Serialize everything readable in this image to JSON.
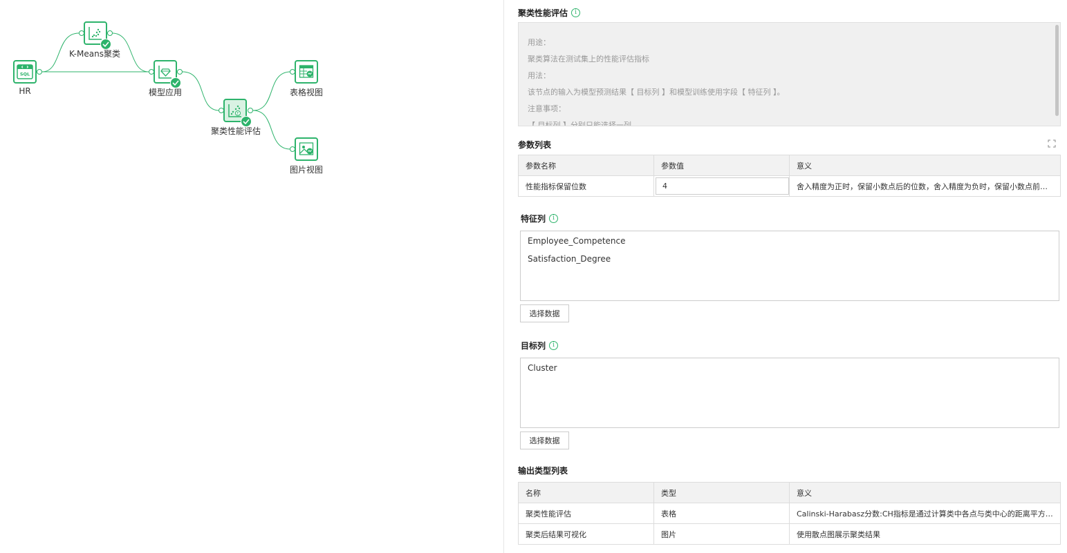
{
  "canvas": {
    "nodes": {
      "hr": {
        "label": "HR",
        "icon": "sql-icon",
        "icon_text": "SQL"
      },
      "kmeans": {
        "label": "K-Means聚类",
        "icon": "scatter-icon"
      },
      "model_apply": {
        "label": "模型应用",
        "icon": "gem-icon"
      },
      "cluster_eval": {
        "label": "聚类性能评估",
        "icon": "scatter-eval-icon"
      },
      "table_view": {
        "label": "表格视图",
        "icon": "table-view-icon"
      },
      "image_view": {
        "label": "图片视图",
        "icon": "image-view-icon"
      }
    },
    "accent_color": "#2db36b"
  },
  "panel": {
    "title": "聚类性能评估",
    "description": [
      "用途：",
      "聚类算法在测试集上的性能评估指标",
      "用法：",
      "该节点的输入为模型预测结果【 目标列 】和模型训练使用字段【 特征列 】。",
      "注意事项：",
      "【 目标列 】分别只能选择一列"
    ],
    "params": {
      "title": "参数列表",
      "headers": [
        "参数名称",
        "参数值",
        "意义"
      ],
      "rows": [
        {
          "name": "性能指标保留位数",
          "value": "4",
          "meaning": "舍入精度为正时，保留小数点后的位数，舍入精度为负时，保留小数点前的位数"
        }
      ]
    },
    "feature_columns": {
      "title": "特征列",
      "items": [
        "Employee_Competence",
        "Satisfaction_Degree"
      ],
      "button": "选择数据"
    },
    "target_columns": {
      "title": "目标列",
      "items": [
        "Cluster"
      ],
      "button": "选择数据"
    },
    "outputs": {
      "title": "输出类型列表",
      "headers": [
        "名称",
        "类型",
        "意义"
      ],
      "rows": [
        {
          "name": "聚类性能评估",
          "type": "表格",
          "meaning": "Calinski-Harabasz分数:CH指标是通过计算类中各点与类中心的距离平方和来度量类内的紧密度"
        },
        {
          "name": "聚类后结果可视化",
          "type": "图片",
          "meaning": "使用散点图展示聚类结果"
        }
      ]
    }
  }
}
